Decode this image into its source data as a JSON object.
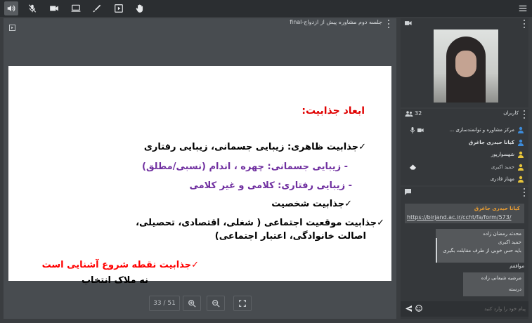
{
  "toolbar": {
    "icons": [
      "speaker-icon",
      "mic-off-icon",
      "camera-icon",
      "screen-share-icon",
      "pen-icon",
      "media-icon",
      "hand-icon"
    ],
    "menu_icon": "menu-icon"
  },
  "presentation": {
    "title": "جلسه دوم مشاوره پیش از ازدواج-final",
    "page_indicator": "33 / 51",
    "slide": {
      "heading": "ابعاد جذابیت:",
      "lines": [
        "✓جذابیت ظاهری: زیبایی جسمانی، زیبایی رفتاری",
        "- زیبایی جسمانی: چهره ، اندام (نسبی/مطلق)",
        "- زیبایی رفتاری: کلامی و غیر کلامی",
        "✓جذابیت شخصیت",
        "✓جذابیت موقعیت اجتماعی ( شغلی، اقتصادی، تحصیلی،",
        "اصالت خانوادگی، اعتبار اجتماعی)",
        "✓جذابیت نقطه شروع آشنایی است",
        "نه ملاک انتخاب"
      ],
      "colors": {
        "heading": "#e00000",
        "normal": "#000000",
        "sub": "#7030a0",
        "highlight": "#ff0000",
        "check": "#e07070"
      }
    }
  },
  "users": {
    "count": "32",
    "title": "کاربران",
    "list": [
      {
        "name": "مرکز مشاوره و توانمندسازی ...",
        "color": "#3d8bd9"
      },
      {
        "name": "کیانا حیدری جاغرق",
        "color": "#3d8bd9"
      },
      {
        "name": "شهسوارپور",
        "color": "#e8c53a"
      },
      {
        "name": "حمید اکبری",
        "color": "#e8c53a"
      },
      {
        "name": "مهناز قادری",
        "color": "#e8c53a"
      }
    ]
  },
  "chat": {
    "messages": [
      {
        "author": "کیانا حیدری جاغرق",
        "text": "https://birjand.ac.ir/ccht/fa/form/573/"
      },
      {
        "author": "محدثه رمضان زاده",
        "text": ""
      },
      {
        "author": "حمید اکبری",
        "text": "باید حس خوبی از طرف مقابلت بگیری"
      },
      {
        "author": "",
        "text": "موافقم"
      },
      {
        "author": "مرضیه شیعانی زاده",
        "text": "درسته"
      }
    ],
    "input_placeholder": "پیام خود را وارد کنید"
  }
}
